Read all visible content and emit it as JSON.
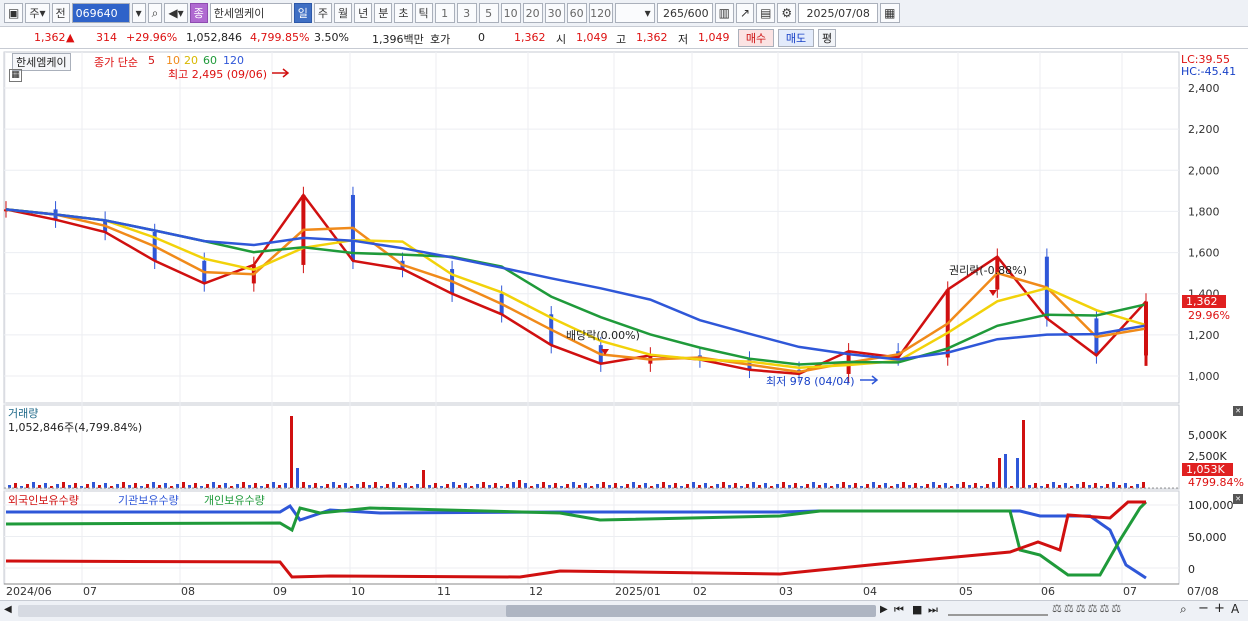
{
  "toolbar": {
    "market": "주",
    "prev": "전",
    "code": "069640",
    "name_badge": "종",
    "name": "한세엠케이",
    "periods": [
      "일",
      "주",
      "월",
      "년",
      "분",
      "초",
      "틱"
    ],
    "active_period": "일",
    "numbers": [
      "1",
      "3",
      "5",
      "10",
      "20",
      "30",
      "60",
      "120"
    ],
    "range": "265",
    "range_total": "/600",
    "date": "2025/07/08"
  },
  "quote": {
    "price": "1,362",
    "change": "314",
    "change_pct": "+29.96%",
    "volume": "1,052,846",
    "volume_pct": "4,799.85%",
    "turnover": "3.50%",
    "amount": "1,396백만",
    "hoga_label": "호가",
    "hoga": "0",
    "hoga_price": "1,362",
    "open_label": "시",
    "open": "1,049",
    "high_label": "고",
    "high": "1,362",
    "low_label": "저",
    "low": "1,049",
    "buy": "매수",
    "sell": "매도",
    "avg": "평"
  },
  "price_panel": {
    "stock_label": "한세엠케이",
    "ma_label": "종가 단순",
    "ma_periods": [
      "5",
      "10",
      "20",
      "60",
      "120"
    ],
    "ma_colors": [
      "#d01010",
      "#f08a1a",
      "#f2d20a",
      "#1f9a3a",
      "#2f57d8"
    ],
    "high_note": "최고 2,495 (09/06)",
    "low_note": "최저 978 (04/04)",
    "dividend_note": "배당락(0.00%)",
    "rights_note": "권리락(-0.88%)",
    "lc": "LC:39.55",
    "hc": "HC:-45.41",
    "last_price_tag": "1,362",
    "last_pct_tag": "29.96%",
    "y_ticks": [
      "2,400",
      "2,200",
      "2,000",
      "1,800",
      "1,600",
      "1,400",
      "1,200",
      "1,000"
    ]
  },
  "volume_panel": {
    "title": "거래량",
    "value": "1,052,846주(4,799.84%)",
    "y_ticks": [
      "5,000K",
      "2,500K"
    ],
    "last_tag": "1,053K",
    "last_pct": "4799.84%"
  },
  "holding_panel": {
    "series": [
      "외국인보유수량",
      "기관보유수량",
      "개인보유수량"
    ],
    "series_colors": [
      "#d01010",
      "#2f57d8",
      "#1f9a3a"
    ],
    "y_ticks": [
      "100,000",
      "50,000",
      "0"
    ]
  },
  "x_axis": [
    "2024/06",
    "07",
    "08",
    "09",
    "10",
    "11",
    "12",
    "2025/01",
    "02",
    "03",
    "04",
    "05",
    "06",
    "07",
    "07/08"
  ],
  "chart_data": {
    "type": "line",
    "ylim": [
      900,
      2500
    ],
    "close_series": [
      {
        "x": "2024/06",
        "y": 1810
      },
      {
        "x": "07",
        "y": 1760
      },
      {
        "x": "07",
        "y": 1700
      },
      {
        "x": "08",
        "y": 1560
      },
      {
        "x": "08",
        "y": 1450
      },
      {
        "x": "09",
        "y": 1540
      },
      {
        "x": "09",
        "y": 1880
      },
      {
        "x": "10",
        "y": 1560
      },
      {
        "x": "10",
        "y": 1520
      },
      {
        "x": "11",
        "y": 1400
      },
      {
        "x": "11",
        "y": 1300
      },
      {
        "x": "12",
        "y": 1150
      },
      {
        "x": "12",
        "y": 1060
      },
      {
        "x": "2025/01",
        "y": 1100
      },
      {
        "x": "02",
        "y": 1080
      },
      {
        "x": "03",
        "y": 1030
      },
      {
        "x": "04",
        "y": 1010
      },
      {
        "x": "04",
        "y": 1120
      },
      {
        "x": "05",
        "y": 1090
      },
      {
        "x": "05",
        "y": 1420
      },
      {
        "x": "06",
        "y": 1580
      },
      {
        "x": "06",
        "y": 1280
      },
      {
        "x": "07",
        "y": 1100
      },
      {
        "x": "07/08",
        "y": 1362
      }
    ]
  }
}
